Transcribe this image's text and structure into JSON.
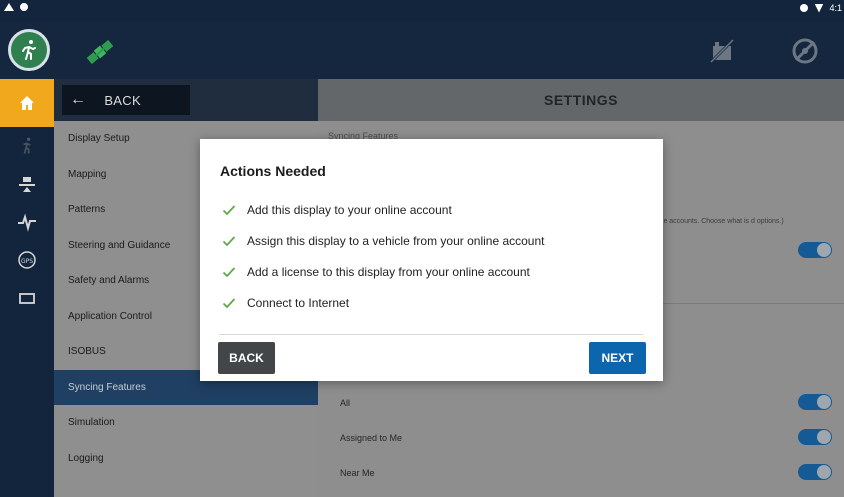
{
  "status_bar": {
    "time": "4:1"
  },
  "menu": {
    "back_label": "BACK",
    "items": [
      {
        "label": "Display Setup"
      },
      {
        "label": "Mapping"
      },
      {
        "label": "Patterns"
      },
      {
        "label": "Steering and Guidance"
      },
      {
        "label": "Safety and Alarms"
      },
      {
        "label": "Application Control"
      },
      {
        "label": "ISOBUS"
      },
      {
        "label": "Syncing Features",
        "active": true
      },
      {
        "label": "Simulation"
      },
      {
        "label": "Logging"
      }
    ]
  },
  "main": {
    "title": "SETTINGS",
    "section_label": "Syncing Features",
    "description": "ble accounts. Choose what is d options.)",
    "rows": [
      {
        "label": "All"
      },
      {
        "label": "Assigned to Me"
      },
      {
        "label": "Near Me"
      }
    ]
  },
  "modal": {
    "title": "Actions Needed",
    "items": [
      "Add this display to your online account",
      "Assign this display to a vehicle from your online account",
      "Add a license to this display from your online account",
      "Connect to Internet"
    ],
    "back_label": "BACK",
    "next_label": "NEXT"
  },
  "colors": {
    "accent_blue": "#0d66ad",
    "nav_dark": "#13253d",
    "home_orange": "#f2a81d",
    "check_green": "#5fa845"
  }
}
